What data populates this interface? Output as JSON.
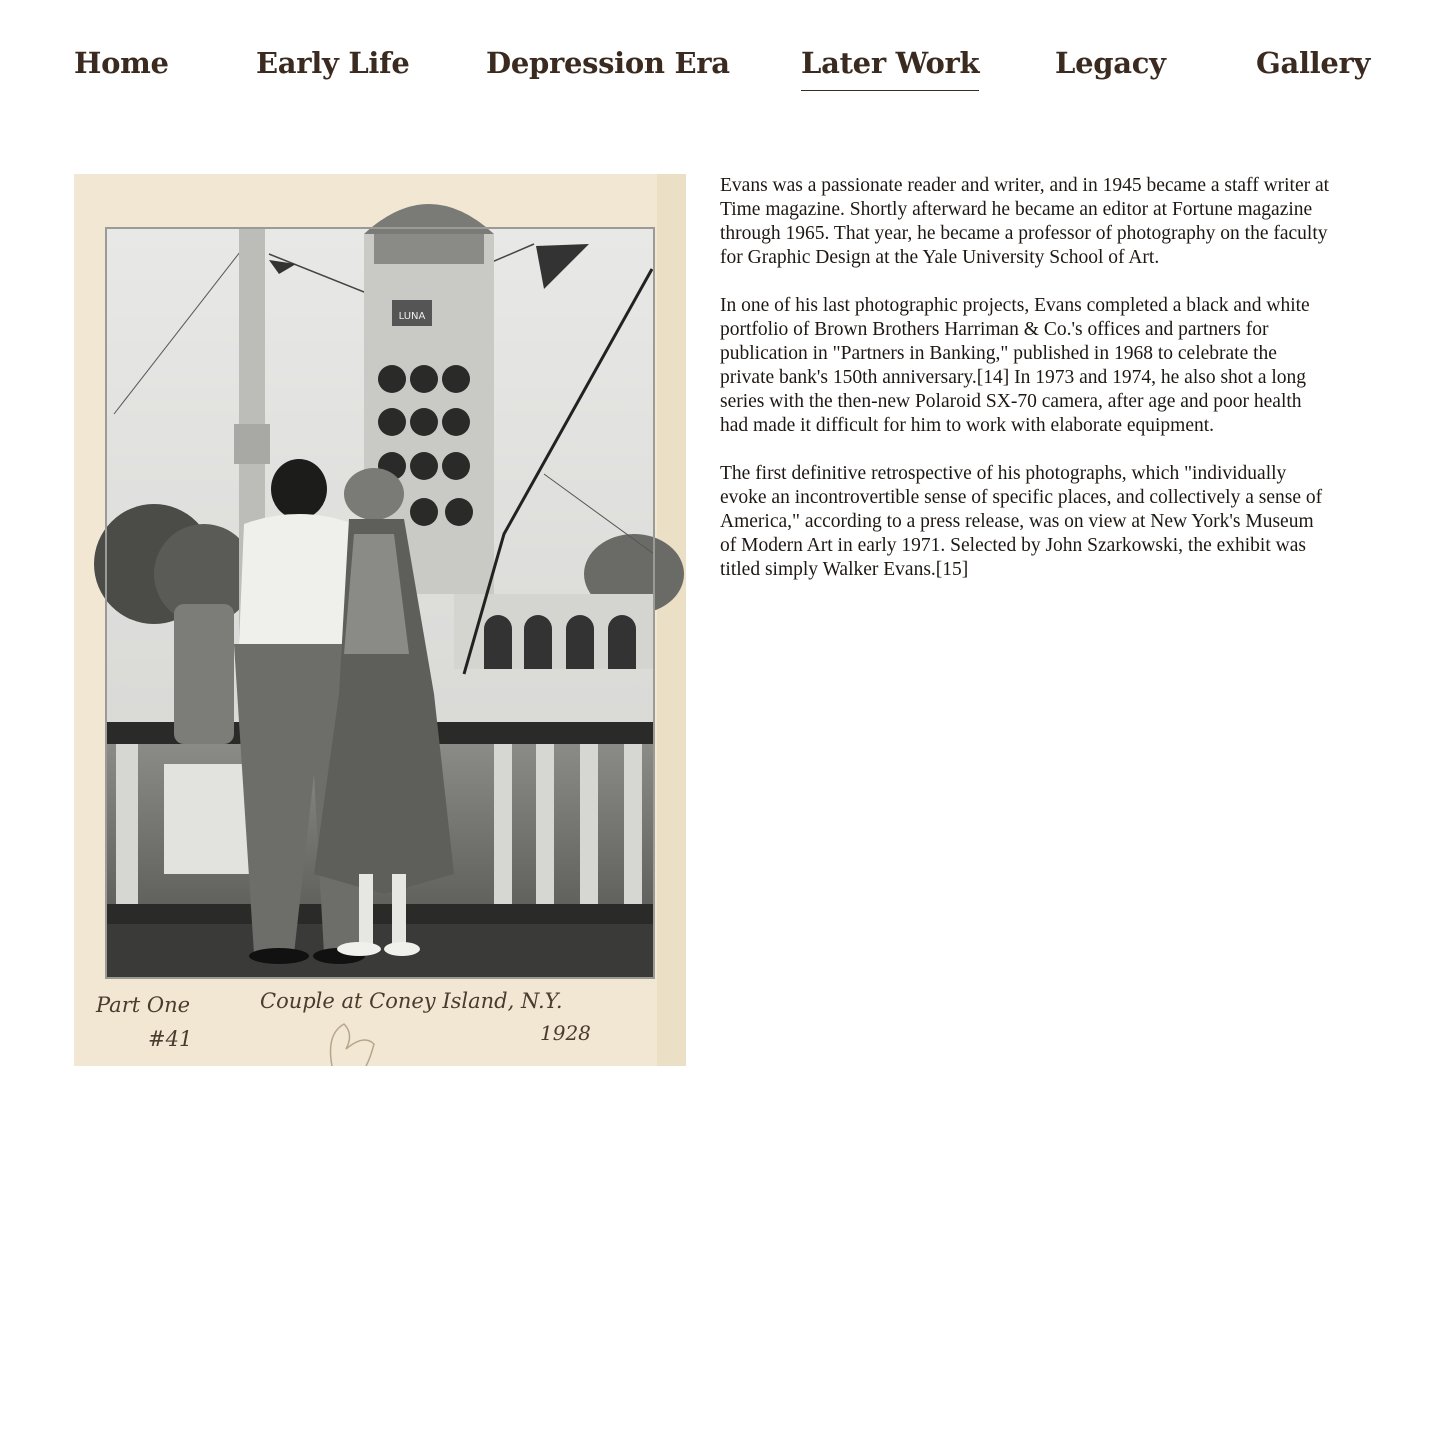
{
  "nav": {
    "items": [
      {
        "label": "Home",
        "active": false
      },
      {
        "label": "Early Life",
        "active": false
      },
      {
        "label": "Depression Era",
        "active": false
      },
      {
        "label": "Later Work",
        "active": true
      },
      {
        "label": "Legacy",
        "active": false
      },
      {
        "label": "Gallery",
        "active": false
      }
    ]
  },
  "photo": {
    "caption_left_line1": "Part One",
    "caption_left_line2": "#41",
    "caption_title": "Couple at Coney Island, N.Y.",
    "caption_year": "1928",
    "sign_text": "LUNA"
  },
  "content": {
    "paragraphs": [
      "Evans was a passionate reader and writer, and in 1945 became a staff writer at Time magazine. Shortly afterward he became an editor at Fortune magazine through 1965. That year, he became a professor of photography on the faculty for Graphic Design at the Yale University School of Art.",
      "In one of his last photographic projects, Evans completed a black and white portfolio of Brown Brothers Harriman & Co.'s offices and partners for publication in \"Partners in Banking,\" published in 1968 to celebrate the private bank's 150th anniversary.[14] In 1973 and 1974, he also shot a long series with the then-new Polaroid SX-70 camera, after age and poor health had made it difficult for him to work with elaborate equipment.",
      "The first definitive retrospective of his photographs, which \"individually evoke an incontrovertible sense of specific places, and collectively a sense of America,\" according to a press release, was on view at New York's Museum of Modern Art in early 1971. Selected by John Szarkowski, the exhibit was titled simply Walker Evans.[15]"
    ]
  },
  "colors": {
    "text": "#2b1d14",
    "mat": "#f1e7d2"
  }
}
